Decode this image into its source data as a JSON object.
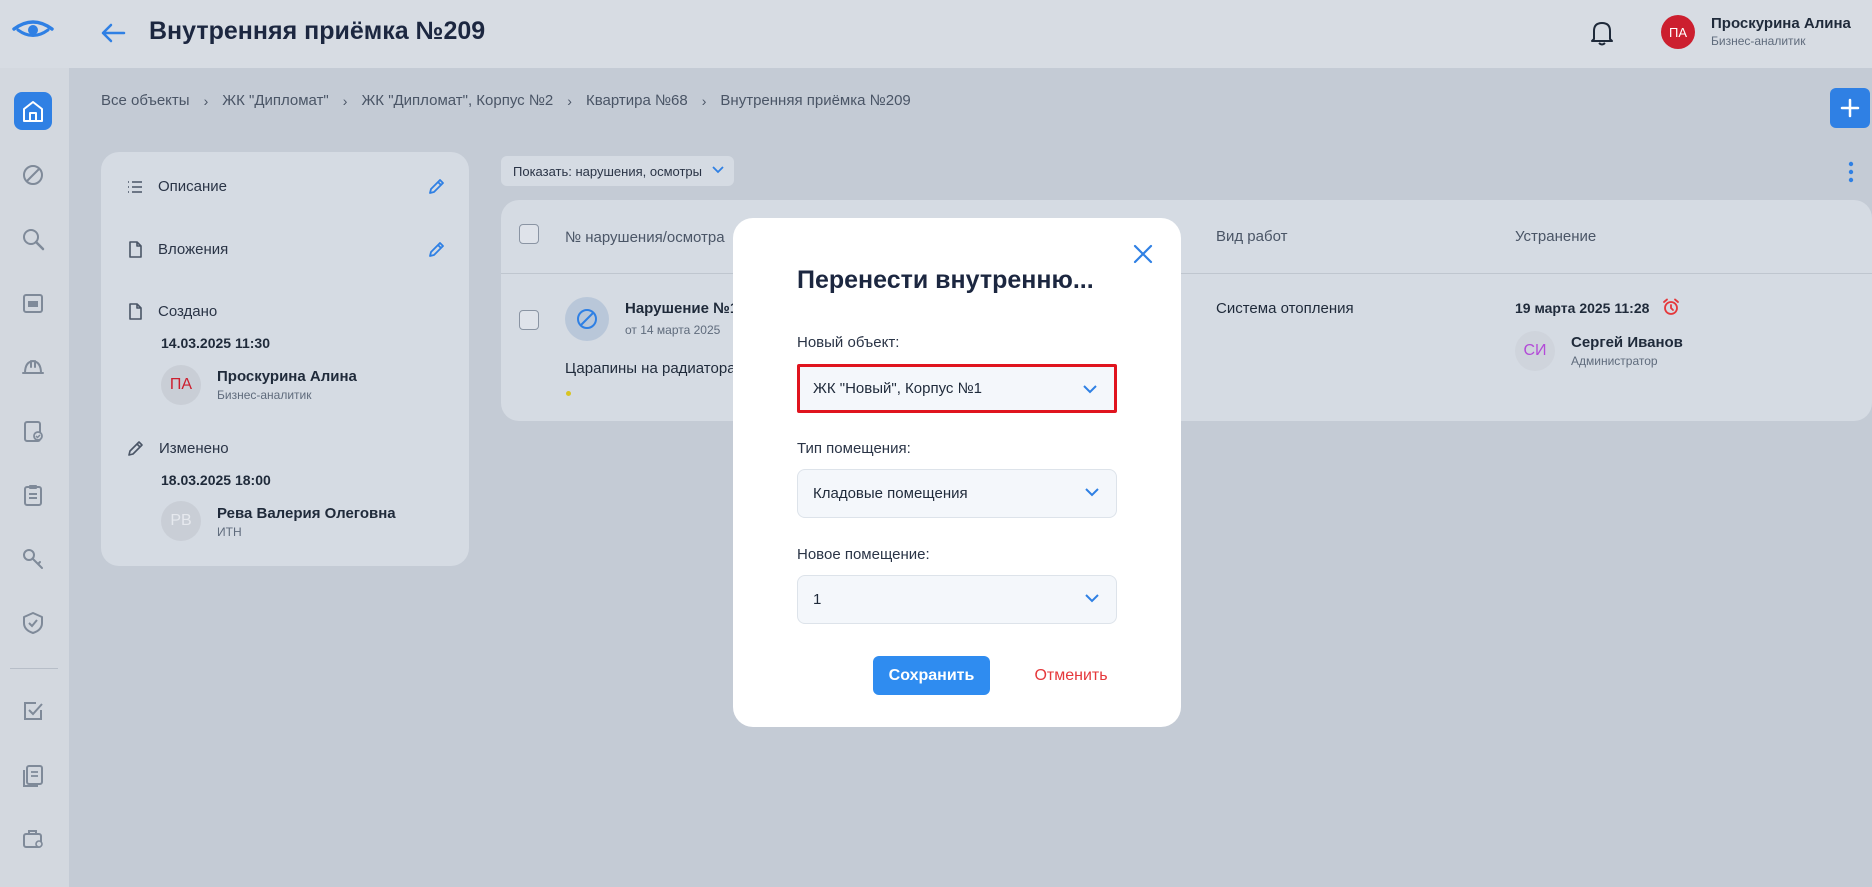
{
  "header": {
    "title": "Внутренняя приёмка №209",
    "user": {
      "initials": "ПА",
      "name": "Проскурина Алина",
      "role": "Бизнес-аналитик"
    }
  },
  "breadcrumb": [
    "Все объекты",
    "ЖК \"Дипломат\"",
    "ЖК \"Дипломат\", Корпус №2",
    "Квартира №68",
    "Внутренняя приёмка №209"
  ],
  "info": {
    "description_label": "Описание",
    "attachments_label": "Вложения",
    "created": {
      "label": "Создано",
      "date": "14.03.2025 11:30",
      "initials": "ПА",
      "name": "Проскурина Алина",
      "role": "Бизнес-аналитик"
    },
    "modified": {
      "label": "Изменено",
      "date": "18.03.2025 18:00",
      "initials": "РВ",
      "name": "Рева Валерия Олеговна",
      "role": "ИТН"
    }
  },
  "filter": {
    "label": "Показать: нарушения, осмотры"
  },
  "table": {
    "columns": {
      "number": "№ нарушения/осмотра",
      "work_type": "Вид работ",
      "fix": "Устранение"
    },
    "row": {
      "title": "Нарушение №1",
      "date": "от 14 марта 2025",
      "description": "Царапины на радиатора",
      "work_type": "Система отопления",
      "fix_date": "19 марта 2025 11:28",
      "assignee_initials": "СИ",
      "assignee_name": "Сергей Иванов",
      "assignee_role": "Администратор"
    }
  },
  "modal": {
    "title": "Перенести внутренню...",
    "new_object": {
      "label": "Новый объект:",
      "value": "ЖК \"Новый\", Корпус №1"
    },
    "room_type": {
      "label": "Тип помещения:",
      "value": "Кладовые помещения"
    },
    "new_room": {
      "label": "Новое помещение:",
      "value": "1"
    },
    "save": "Сохранить",
    "cancel": "Отменить"
  },
  "colors": {
    "accent": "#2f80e4",
    "danger": "#e5383b",
    "highlight": "#e0141e",
    "avatar_red": "#cc1f2f"
  }
}
